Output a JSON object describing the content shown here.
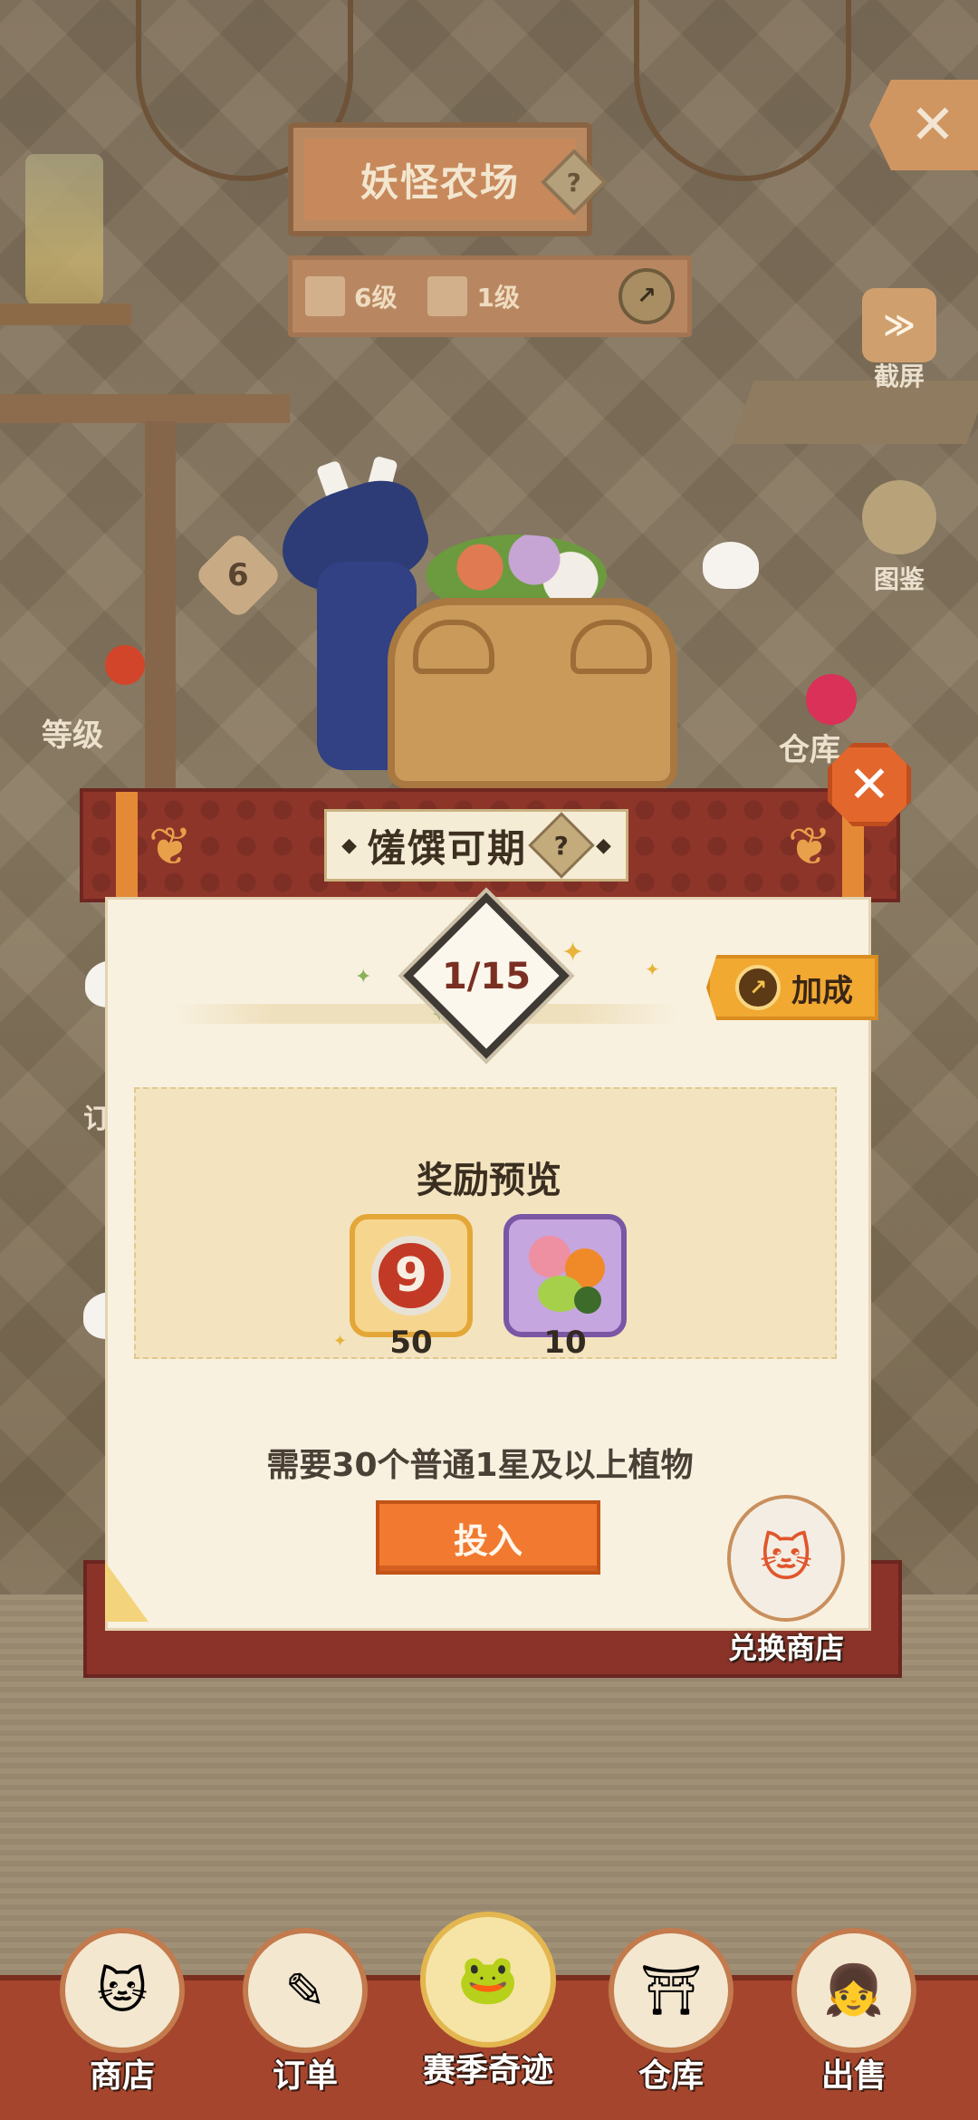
{
  "hud": {
    "farm_title": "妖怪农场",
    "help_glyph": "?",
    "level_a": "6级",
    "level_b": "1级",
    "trend_glyph": "↗",
    "close_glyph": "✕"
  },
  "side": {
    "screenshot_label": "截屏",
    "screenshot_glyph": "≫",
    "guide_label": "图鉴",
    "level_label": "等级",
    "level_value": "6",
    "warehouse_label": "仓库",
    "order_label": "订"
  },
  "modal": {
    "title": "馐馔可期",
    "title_help": "?",
    "title_diamond": "◆",
    "close_glyph": "✕",
    "progress": "1/15",
    "progress_current": 1,
    "progress_total": 15,
    "bonus_label": "加成",
    "bonus_glyph": "↗",
    "reward_title": "奖励预览",
    "rewards": [
      {
        "icon": "coin-nine-icon",
        "glyph": "9",
        "count": "50"
      },
      {
        "icon": "flower-dish-icon",
        "glyph": "",
        "count": "10"
      }
    ],
    "requirement": "需要30个普通1星及以上植物",
    "submit_label": "投入",
    "exchange_shop_label": "兑换商店",
    "exchange_shop_glyph": "🐱"
  },
  "nav": [
    {
      "label": "商店",
      "glyph": "🐱",
      "icon": "lucky-cat-icon"
    },
    {
      "label": "订单",
      "glyph": "✎",
      "icon": "order-icon"
    },
    {
      "label": "赛季奇迹",
      "glyph": "🐸",
      "icon": "season-frog-icon"
    },
    {
      "label": "仓库",
      "glyph": "⛩",
      "icon": "warehouse-icon"
    },
    {
      "label": "出售",
      "glyph": "👧",
      "icon": "seller-avatar-icon"
    }
  ],
  "colors": {
    "header_red": "#8e352a",
    "accent_orange": "#f27a30",
    "bonus_gold": "#f1a932",
    "paper": "#f8f1e0"
  }
}
